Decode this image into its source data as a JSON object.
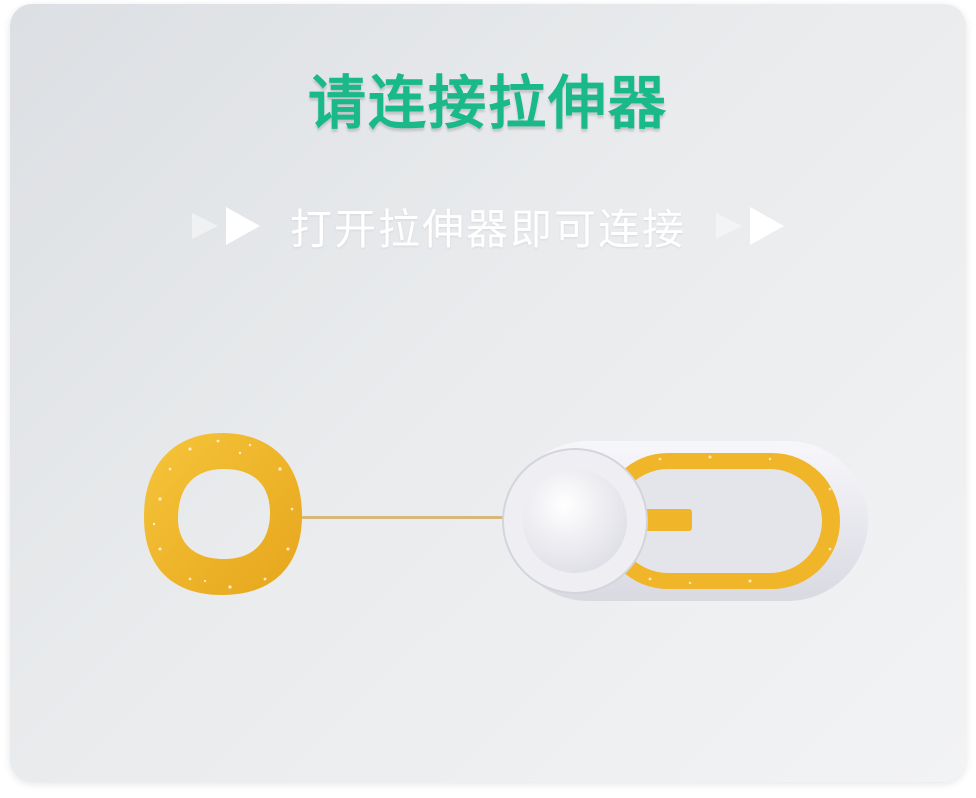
{
  "dialog": {
    "title": "请连接拉伸器",
    "hint": "打开拉伸器即可连接"
  },
  "icons": {
    "left_arrows": "play-arrow-icon",
    "right_arrows": "play-arrow-icon",
    "device": "stretcher-device-illustration"
  },
  "colors": {
    "title": "#19b98a",
    "hint": "#ffffff",
    "ring": "#f0b528",
    "device_body": "#e9e9ef"
  }
}
